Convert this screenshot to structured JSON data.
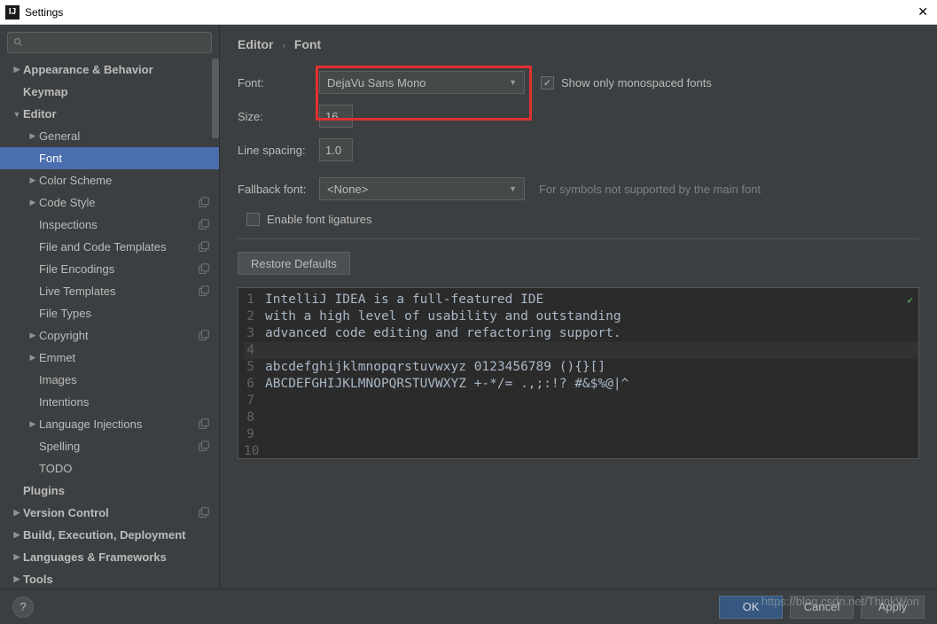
{
  "window": {
    "title": "Settings"
  },
  "sidebar": {
    "items": [
      {
        "label": "Appearance & Behavior",
        "level": 1,
        "arrow": "right",
        "bold": true,
        "badge": false
      },
      {
        "label": "Keymap",
        "level": 1,
        "arrow": "none",
        "bold": true,
        "badge": false,
        "pad": true
      },
      {
        "label": "Editor",
        "level": 1,
        "arrow": "down",
        "bold": true,
        "badge": false
      },
      {
        "label": "General",
        "level": 2,
        "arrow": "right",
        "bold": false,
        "badge": false
      },
      {
        "label": "Font",
        "level": 2,
        "arrow": "none",
        "bold": false,
        "badge": false,
        "pad": true,
        "selected": true
      },
      {
        "label": "Color Scheme",
        "level": 2,
        "arrow": "right",
        "bold": false,
        "badge": false
      },
      {
        "label": "Code Style",
        "level": 2,
        "arrow": "right",
        "bold": false,
        "badge": true
      },
      {
        "label": "Inspections",
        "level": 2,
        "arrow": "none",
        "bold": false,
        "badge": true,
        "pad": true
      },
      {
        "label": "File and Code Templates",
        "level": 2,
        "arrow": "none",
        "bold": false,
        "badge": true,
        "pad": true
      },
      {
        "label": "File Encodings",
        "level": 2,
        "arrow": "none",
        "bold": false,
        "badge": true,
        "pad": true
      },
      {
        "label": "Live Templates",
        "level": 2,
        "arrow": "none",
        "bold": false,
        "badge": true,
        "pad": true
      },
      {
        "label": "File Types",
        "level": 2,
        "arrow": "none",
        "bold": false,
        "badge": false,
        "pad": true
      },
      {
        "label": "Copyright",
        "level": 2,
        "arrow": "right",
        "bold": false,
        "badge": true
      },
      {
        "label": "Emmet",
        "level": 2,
        "arrow": "right",
        "bold": false,
        "badge": false
      },
      {
        "label": "Images",
        "level": 2,
        "arrow": "none",
        "bold": false,
        "badge": false,
        "pad": true
      },
      {
        "label": "Intentions",
        "level": 2,
        "arrow": "none",
        "bold": false,
        "badge": false,
        "pad": true
      },
      {
        "label": "Language Injections",
        "level": 2,
        "arrow": "right",
        "bold": false,
        "badge": true
      },
      {
        "label": "Spelling",
        "level": 2,
        "arrow": "none",
        "bold": false,
        "badge": true,
        "pad": true
      },
      {
        "label": "TODO",
        "level": 2,
        "arrow": "none",
        "bold": false,
        "badge": false,
        "pad": true
      },
      {
        "label": "Plugins",
        "level": 1,
        "arrow": "none",
        "bold": true,
        "badge": false,
        "pad": true
      },
      {
        "label": "Version Control",
        "level": 1,
        "arrow": "right",
        "bold": true,
        "badge": true
      },
      {
        "label": "Build, Execution, Deployment",
        "level": 1,
        "arrow": "right",
        "bold": true,
        "badge": false
      },
      {
        "label": "Languages & Frameworks",
        "level": 1,
        "arrow": "right",
        "bold": true,
        "badge": false
      },
      {
        "label": "Tools",
        "level": 1,
        "arrow": "right",
        "bold": true,
        "badge": false
      }
    ]
  },
  "breadcrumb": {
    "a": "Editor",
    "b": "Font"
  },
  "form": {
    "font_label": "Font:",
    "font_value": "DejaVu Sans Mono",
    "mono_label": "Show only monospaced fonts",
    "mono_checked": true,
    "size_label": "Size:",
    "size_value": "16",
    "line_spacing_label": "Line spacing:",
    "line_spacing_value": "1.0",
    "fallback_label": "Fallback font:",
    "fallback_value": "<None>",
    "fallback_hint": "For symbols not supported by the main font",
    "ligatures_label": "Enable font ligatures",
    "ligatures_checked": false,
    "restore_label": "Restore Defaults"
  },
  "preview": {
    "lines": [
      "IntelliJ IDEA is a full-featured IDE",
      "with a high level of usability and outstanding",
      "advanced code editing and refactoring support.",
      "",
      "abcdefghijklmnopqrstuvwxyz 0123456789 (){}[]",
      "ABCDEFGHIJKLMNOPQRSTUVWXYZ +-*/= .,;:!? #&$%@|^",
      "",
      "",
      "",
      ""
    ]
  },
  "footer": {
    "ok": "OK",
    "cancel": "Cancel",
    "apply": "Apply"
  },
  "watermark": "https://blog.csdn.net/ThinkWon"
}
